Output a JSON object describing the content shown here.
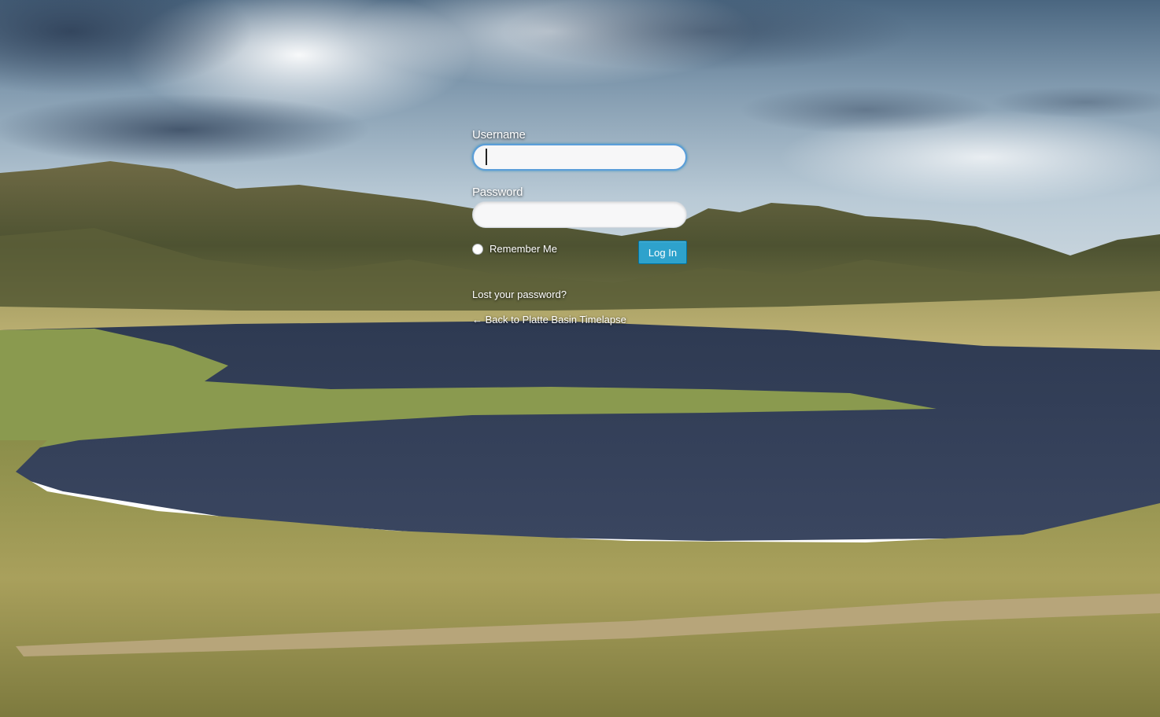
{
  "form": {
    "username_label": "Username",
    "username_value": "",
    "password_label": "Password",
    "password_value": "",
    "remember_label": "Remember Me",
    "remember_checked": false,
    "login_button": "Log In"
  },
  "links": {
    "lost_password": "Lost your password?",
    "back_to_site": "← Back to Platte Basin Timelapse"
  },
  "colors": {
    "button": "#2ea2cc",
    "button_border": "#0074a2",
    "focus_ring": "#5b9dd9"
  }
}
